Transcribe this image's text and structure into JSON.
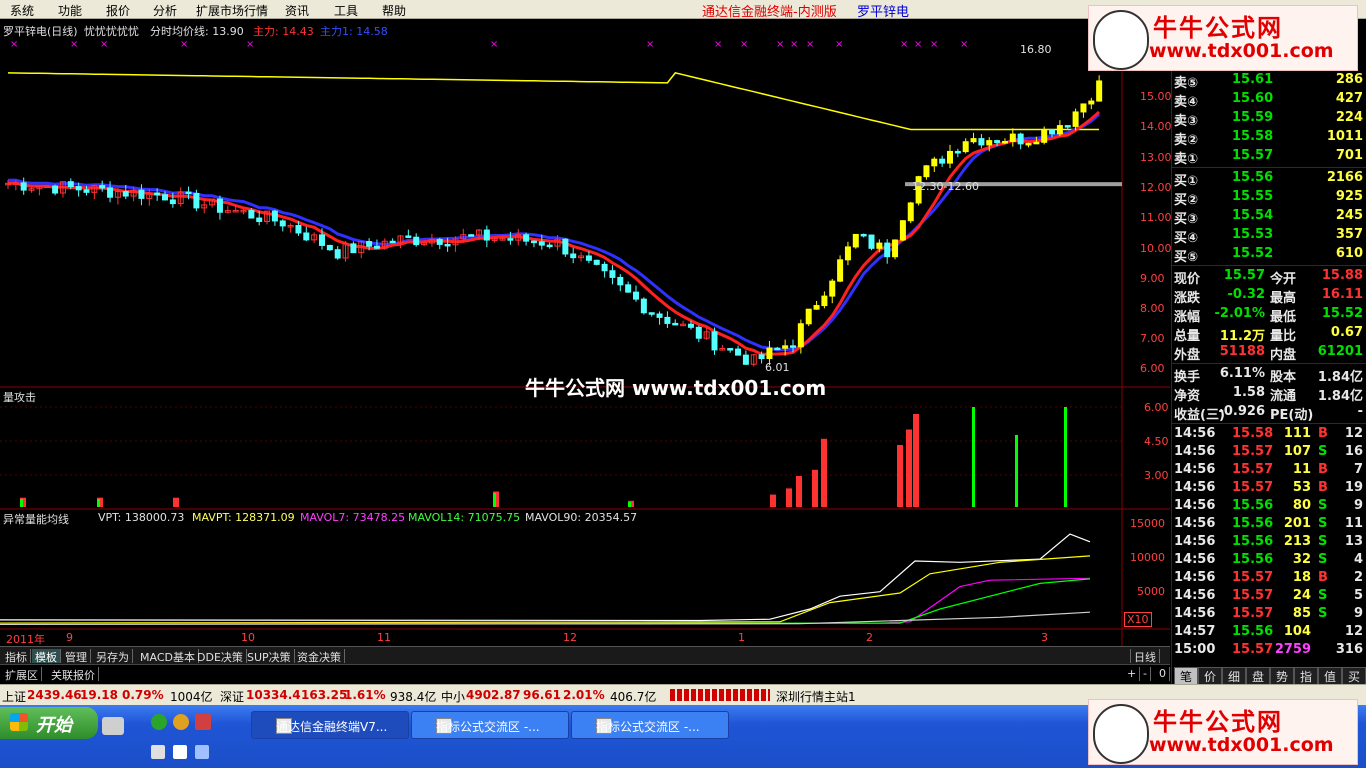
{
  "menu": [
    "系统",
    "功能",
    "报价",
    "分析",
    "扩展市场行情",
    "资讯",
    "工具",
    "帮助"
  ],
  "title": {
    "app": "通达信金融终端-内测版",
    "stock": "罗平锌电"
  },
  "panel1": {
    "label_name": "罗平锌电(日线)",
    "label_extra": "忧忧忧忧忧",
    "avg_label": "分时均价线: 13.90",
    "zl_label": "主力: 14.43",
    "zl1_label": "主力1: 14.58",
    "high_label": "16.80",
    "range_label": "12.30-12.60",
    "low_label": "6.01",
    "y_ticks": [
      "15.00",
      "14.00",
      "13.00",
      "12.00",
      "11.00",
      "10.00",
      "9.00",
      "8.00",
      "7.00",
      "6.00"
    ]
  },
  "panel2": {
    "label": "量攻击",
    "y_ticks": [
      "6.00",
      "4.50",
      "3.00"
    ]
  },
  "panel3": {
    "label": "异常量能均线",
    "vpt": "VPT: 138000.73",
    "mavpt": "MAVPT: 128371.09",
    "mavol7": "MAVOL7: 73478.25",
    "mavol14": "MAVOL14: 71075.75",
    "mavol90": "MAVOL90: 20354.57",
    "y_ticks": [
      "15000",
      "10000",
      "5000"
    ],
    "scale_badge": "X10"
  },
  "x_axis": {
    "labels": [
      "2011年",
      "9",
      "10",
      "11",
      "12",
      "1",
      "2",
      "3"
    ]
  },
  "colors": {
    "up": "#ff3232",
    "down": "#54ffff",
    "yellow": "#ffff00",
    "ma_red": "#ff2020",
    "ma_blue": "#3030ff",
    "white": "#ffffff",
    "magenta": "#ff00ff",
    "green": "#00ff00",
    "grid_red": "#8b0000"
  },
  "chart_data": {
    "type": "candlestick",
    "price_range": [
      6.0,
      16.8
    ],
    "annotations": [
      "16.80",
      "12.30-12.60",
      "6.01"
    ],
    "volume_attack_range": [
      0,
      6.0
    ],
    "vol_indicator_range": [
      0,
      15000
    ]
  },
  "tabs": [
    "指标",
    "模板",
    "管理",
    "另存为",
    "MACD基本",
    "DDE决策",
    "SUP决策",
    "资金决策"
  ],
  "tab_active": "模板",
  "tab_controls": [
    "日线",
    "+",
    "-",
    "0"
  ],
  "sub_tabs": [
    "扩展区",
    "关联报价"
  ],
  "quote": {
    "sells": [
      {
        "label": "卖⑤",
        "price": "15.61",
        "vol": "286"
      },
      {
        "label": "卖④",
        "price": "15.60",
        "vol": "427"
      },
      {
        "label": "卖③",
        "price": "15.59",
        "vol": "224"
      },
      {
        "label": "卖②",
        "price": "15.58",
        "vol": "1011"
      },
      {
        "label": "卖①",
        "price": "15.57",
        "vol": "701"
      }
    ],
    "buys": [
      {
        "label": "买①",
        "price": "15.56",
        "vol": "2166"
      },
      {
        "label": "买②",
        "price": "15.55",
        "vol": "925"
      },
      {
        "label": "买③",
        "price": "15.54",
        "vol": "245"
      },
      {
        "label": "买④",
        "price": "15.53",
        "vol": "357"
      },
      {
        "label": "买⑤",
        "price": "15.52",
        "vol": "610"
      }
    ],
    "stats": [
      {
        "l1": "现价",
        "v1": "15.57",
        "l2": "今开",
        "v2": "15.88"
      },
      {
        "l1": "涨跌",
        "v1": "-0.32",
        "l2": "最高",
        "v2": "16.11"
      },
      {
        "l1": "涨幅",
        "v1": "-2.01%",
        "l2": "最低",
        "v2": "15.52"
      },
      {
        "l1": "总量",
        "v1": "11.2万",
        "l2": "量比",
        "v2": "0.67"
      },
      {
        "l1": "外盘",
        "v1": "51188",
        "l2": "内盘",
        "v2": "61201"
      },
      {
        "l1": "换手",
        "v1": "6.11%",
        "l2": "股本",
        "v2": "1.84亿"
      },
      {
        "l1": "净资",
        "v1": "1.58",
        "l2": "流通",
        "v2": "1.84亿"
      },
      {
        "l1": "收益(三)",
        "v1": "-0.926",
        "l2": "PE(动)",
        "v2": "-"
      }
    ],
    "ticks": [
      {
        "t": "14:56",
        "p": "15.58",
        "v": "111",
        "d": "B",
        "n": "12"
      },
      {
        "t": "14:56",
        "p": "15.57",
        "v": "107",
        "d": "S",
        "n": "16"
      },
      {
        "t": "14:56",
        "p": "15.57",
        "v": "11",
        "d": "B",
        "n": "7"
      },
      {
        "t": "14:56",
        "p": "15.57",
        "v": "53",
        "d": "B",
        "n": "19"
      },
      {
        "t": "14:56",
        "p": "15.56",
        "v": "80",
        "d": "S",
        "n": "9"
      },
      {
        "t": "14:56",
        "p": "15.56",
        "v": "201",
        "d": "S",
        "n": "11"
      },
      {
        "t": "14:56",
        "p": "15.56",
        "v": "213",
        "d": "S",
        "n": "13"
      },
      {
        "t": "14:56",
        "p": "15.56",
        "v": "32",
        "d": "S",
        "n": "4"
      },
      {
        "t": "14:56",
        "p": "15.57",
        "v": "18",
        "d": "B",
        "n": "2"
      },
      {
        "t": "14:56",
        "p": "15.57",
        "v": "24",
        "d": "S",
        "n": "5"
      },
      {
        "t": "14:56",
        "p": "15.57",
        "v": "85",
        "d": "S",
        "n": "9"
      },
      {
        "t": "14:57",
        "p": "15.56",
        "v": "104",
        "d": "",
        "n": "12"
      },
      {
        "t": "15:00",
        "p": "15.57",
        "v": "2759",
        "d": "",
        "n": "316"
      }
    ],
    "bottom_tabs": [
      "笔",
      "价",
      "细",
      "盘",
      "势",
      "指",
      "值",
      "买"
    ]
  },
  "status": {
    "sh_label": "上证",
    "sh": "2439.46",
    "sh_chg": "19.18",
    "sh_pct": "0.79%",
    "sh_amt": "1004亿",
    "sz_label": "深证",
    "sz": "10334.4",
    "sz_chg": "163.25",
    "sz_pct": "1.61%",
    "sz_amt": "938.4亿",
    "zx_label": "中小",
    "zx": "4902.87",
    "zx_chg": "96.61",
    "zx_pct": "2.01%",
    "zx_amt": "406.7亿",
    "server": "深圳行情主站1"
  },
  "taskbar": {
    "start": "开始",
    "items": [
      "通达信金融终端V7...",
      "指标公式交流区 -...",
      "指标公式交流区 -..."
    ]
  },
  "watermark": {
    "t1": "牛牛公式网",
    "t2": "www.tdx001.com",
    "center": "牛牛公式网  www.tdx001.com"
  }
}
